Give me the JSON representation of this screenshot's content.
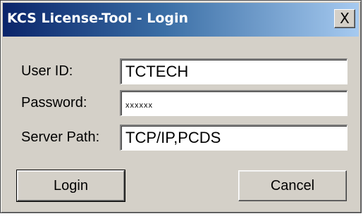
{
  "window": {
    "title": "KCS License-Tool - Login",
    "close_label": "X"
  },
  "form": {
    "user_id": {
      "label": "User ID:",
      "value": "TCTECH"
    },
    "password": {
      "label": "Password:",
      "value": "xxxxxx"
    },
    "server_path": {
      "label": "Server Path:",
      "value": "TCP/IP,PCDS"
    }
  },
  "buttons": {
    "login_label": "Login",
    "cancel_label": "Cancel"
  },
  "colors": {
    "titlebar_start": "#0a246a",
    "titlebar_end": "#a6caf0",
    "dialog_face": "#d4d0c8"
  }
}
